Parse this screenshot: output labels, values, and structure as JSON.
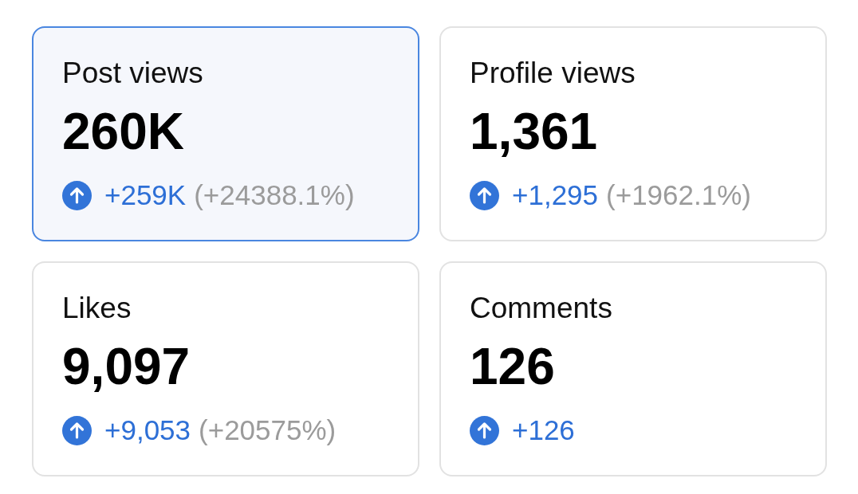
{
  "cards": [
    {
      "label": "Post views",
      "value": "260K",
      "change": "+259K",
      "percent": "(+24388.1%)",
      "selected": true
    },
    {
      "label": "Profile views",
      "value": "1,361",
      "change": "+1,295",
      "percent": "(+1962.1%)",
      "selected": false
    },
    {
      "label": "Likes",
      "value": "9,097",
      "change": "+9,053",
      "percent": "(+20575%)",
      "selected": false
    },
    {
      "label": "Comments",
      "value": "126",
      "change": "+126",
      "selected": false
    }
  ]
}
